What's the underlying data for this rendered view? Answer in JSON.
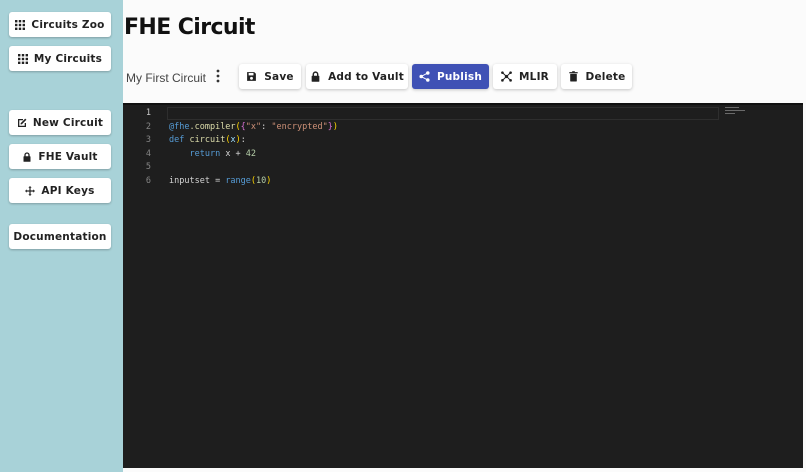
{
  "sidebar": {
    "items": [
      {
        "label": "Circuits Zoo",
        "icon": "grid-icon"
      },
      {
        "label": "My Circuits",
        "icon": "grid-icon"
      },
      {
        "label": "New Circuit",
        "icon": "edit-icon"
      },
      {
        "label": "FHE Vault",
        "icon": "lock-icon"
      },
      {
        "label": "API Keys",
        "icon": "move-icon"
      },
      {
        "label": "Documentation",
        "icon": ""
      }
    ]
  },
  "header": {
    "title": "FHE Circuit",
    "circuit_name": "My First Circuit"
  },
  "toolbar": {
    "save_label": "Save",
    "vault_label": "Add to Vault",
    "publish_label": "Publish",
    "mlir_label": "MLIR",
    "delete_label": "Delete",
    "accent_color": "#3f51b5"
  },
  "editor": {
    "line_numbers": [
      "1",
      "2",
      "3",
      "4",
      "5",
      "6"
    ],
    "lines": {
      "l2": {
        "deco": "@fhe",
        "call": ".compiler",
        "open": "(",
        "brace_open": "{",
        "key": "\"x\"",
        "colon": ": ",
        "val": "\"encrypted\"",
        "brace_close": "}",
        "close": ")"
      },
      "l3": {
        "kw": "def",
        "space": " ",
        "name": "circuit",
        "open": "(",
        "arg": "x",
        "close": ")",
        "colon": ":"
      },
      "l4": {
        "indent": "    ",
        "kw": "return",
        "expr": " x + ",
        "num": "42"
      },
      "l6": {
        "var": "inputset",
        "eq": " = ",
        "fn": "range",
        "open": "(",
        "num": "10",
        "close": ")"
      }
    },
    "background": "#1e1e1e"
  }
}
